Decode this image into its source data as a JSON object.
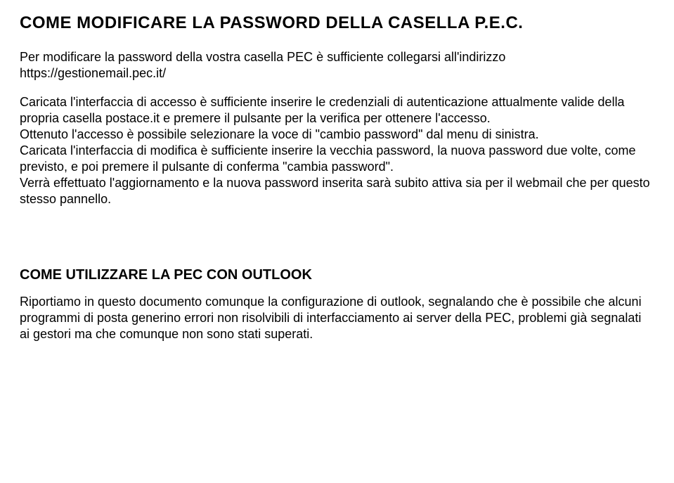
{
  "section1": {
    "title": "COME MODIFICARE LA PASSWORD DELLA CASELLA P.E.C.",
    "p1": "Per modificare la password della vostra casella PEC è sufficiente collegarsi all'indirizzo https://gestionemail.pec.it/",
    "p2": "Caricata l'interfaccia di accesso è sufficiente inserire le credenziali di autenticazione attualmente valide della propria casella postace.it e premere il pulsante per la verifica per ottenere l'accesso.",
    "p3": "Ottenuto l'accesso è possibile selezionare la voce di \"cambio password\" dal menu di sinistra.",
    "p4": "Caricata l'interfaccia di modifica è sufficiente inserire la vecchia password, la nuova password due volte, come previsto, e poi premere il pulsante di conferma \"cambia password\".",
    "p5": "Verrà effettuato l'aggiornamento e la nuova password inserita sarà subito attiva sia per il webmail che per questo stesso pannello."
  },
  "section2": {
    "title": "COME UTILIZZARE LA PEC CON OUTLOOK",
    "p1": "Riportiamo in questo documento comunque la configurazione di outlook, segnalando che è possibile che alcuni programmi di posta generino errori non risolvibili di interfacciamento ai server della PEC, problemi già segnalati ai gestori ma che comunque non sono stati superati."
  }
}
